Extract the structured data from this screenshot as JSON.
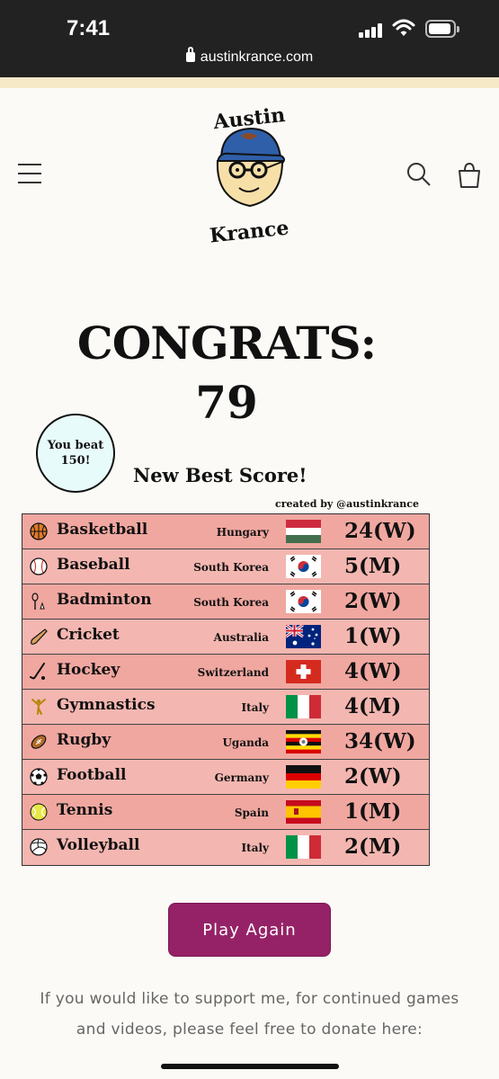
{
  "status_bar": {
    "time": "7:41",
    "url": "austinkrance.com"
  },
  "header": {
    "logo_text_top": "Austin",
    "logo_text_bottom": "Krance"
  },
  "main": {
    "congrats_label": "CONGRATS:",
    "score": "79",
    "beat_line1": "You beat",
    "beat_line2": "150!",
    "new_best": "New Best Score!",
    "credit": "created by @austinkrance"
  },
  "results": [
    {
      "icon": "basketball-icon",
      "sport": "Basketball",
      "country": "Hungary",
      "flag": "hungary",
      "result": "24(W)"
    },
    {
      "icon": "baseball-icon",
      "sport": "Baseball",
      "country": "South Korea",
      "flag": "south-korea",
      "result": "5(M)"
    },
    {
      "icon": "badminton-icon",
      "sport": "Badminton",
      "country": "South Korea",
      "flag": "south-korea",
      "result": "2(W)"
    },
    {
      "icon": "cricket-icon",
      "sport": "Cricket",
      "country": "Australia",
      "flag": "australia",
      "result": "1(W)"
    },
    {
      "icon": "hockey-icon",
      "sport": "Hockey",
      "country": "Switzerland",
      "flag": "switzerland",
      "result": "4(W)"
    },
    {
      "icon": "gymnastics-icon",
      "sport": "Gymnastics",
      "country": "Italy",
      "flag": "italy",
      "result": "4(M)"
    },
    {
      "icon": "rugby-icon",
      "sport": "Rugby",
      "country": "Uganda",
      "flag": "uganda",
      "result": "34(W)"
    },
    {
      "icon": "football-icon",
      "sport": "Football",
      "country": "Germany",
      "flag": "germany",
      "result": "2(W)"
    },
    {
      "icon": "tennis-icon",
      "sport": "Tennis",
      "country": "Spain",
      "flag": "spain",
      "result": "1(M)"
    },
    {
      "icon": "volleyball-icon",
      "sport": "Volleyball",
      "country": "Italy",
      "flag": "italy",
      "result": "2(M)"
    }
  ],
  "play_again_label": "Play Again",
  "support_text": "If you would like to support me, for continued games and videos, please feel free to donate here:",
  "colors": {
    "row": "#f0a7a0",
    "button": "#952267",
    "bubble": "#e8fbfb"
  }
}
